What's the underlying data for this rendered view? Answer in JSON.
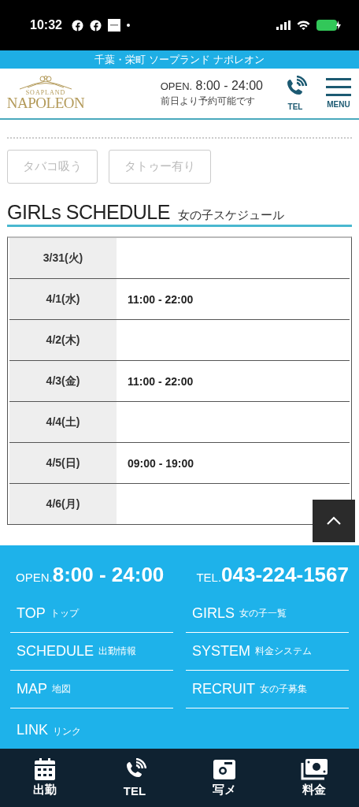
{
  "status_bar": {
    "time": "10:32"
  },
  "top_banner": {
    "title": "千葉・栄町 ソープランド ナポレオン"
  },
  "header": {
    "logo_small": "SOAPLAND",
    "logo": "NAPOLEON",
    "open_label": "OPEN.",
    "open_hours": "8:00 - 24:00",
    "note": "前日より予約可能です",
    "tel_label": "TEL",
    "menu_label": "MENU"
  },
  "tags": [
    {
      "label": "タバコ吸う",
      "selected": false
    },
    {
      "label": "タトゥー有り",
      "selected": false
    }
  ],
  "schedule": {
    "title": "GIRLs SCHEDULE",
    "subtitle": "女の子スケジュール",
    "rows": [
      {
        "date": "3/31(火)"
      },
      {
        "date": "4/1(水)",
        "hours": "11:00 - 22:00"
      },
      {
        "date": "4/2(木)"
      },
      {
        "date": "4/3(金)",
        "hours": "11:00 - 22:00"
      },
      {
        "date": "4/4(土)"
      },
      {
        "date": "4/5(日)",
        "hours": "09:00 - 19:00"
      },
      {
        "date": "4/6(月)"
      }
    ]
  },
  "footer": {
    "open_label": "OPEN.",
    "open_hours": "8:00 - 24:00",
    "tel_label": "TEL.",
    "tel": "043-224-1567",
    "links": [
      {
        "label": "TOP",
        "sub": "トップ"
      },
      {
        "label": "GIRLS",
        "sub": "女の子一覧"
      },
      {
        "label": "SCHEDULE",
        "sub": "出勤情報"
      },
      {
        "label": "SYSTEM",
        "sub": "料金システム"
      },
      {
        "label": "MAP",
        "sub": "地図"
      },
      {
        "label": "RECRUIT",
        "sub": "女の子募集"
      },
      {
        "label": "LINK",
        "sub": "リンク"
      }
    ]
  },
  "bottom_nav": [
    {
      "label": "出勤",
      "kind": "calendar"
    },
    {
      "label": "TEL",
      "kind": "phone"
    },
    {
      "label": "写メ",
      "kind": "camera"
    },
    {
      "label": "料金",
      "kind": "money"
    }
  ]
}
